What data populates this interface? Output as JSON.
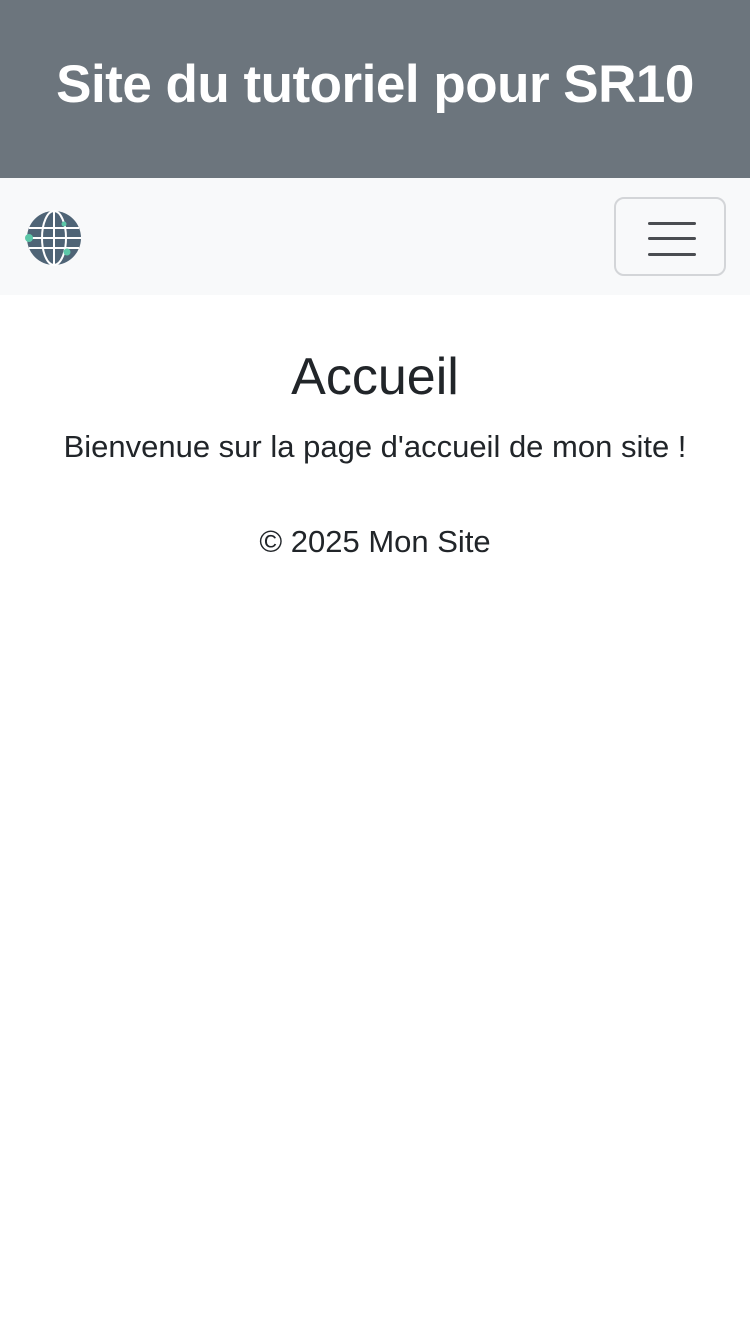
{
  "header": {
    "title": "Site du tutoriel pour SR10"
  },
  "navbar": {
    "logo_icon": "globe-icon",
    "toggler_icon": "hamburger-menu-icon"
  },
  "main": {
    "heading": "Accueil",
    "intro": "Bienvenue sur la page d'accueil de mon site !"
  },
  "footer": {
    "copyright": "© 2025 Mon Site"
  },
  "colors": {
    "header_bg": "#6c757d",
    "navbar_bg": "#f8f9fa",
    "text": "#212529",
    "globe": "#4f6476",
    "globe_accent": "#5cc7a8"
  }
}
